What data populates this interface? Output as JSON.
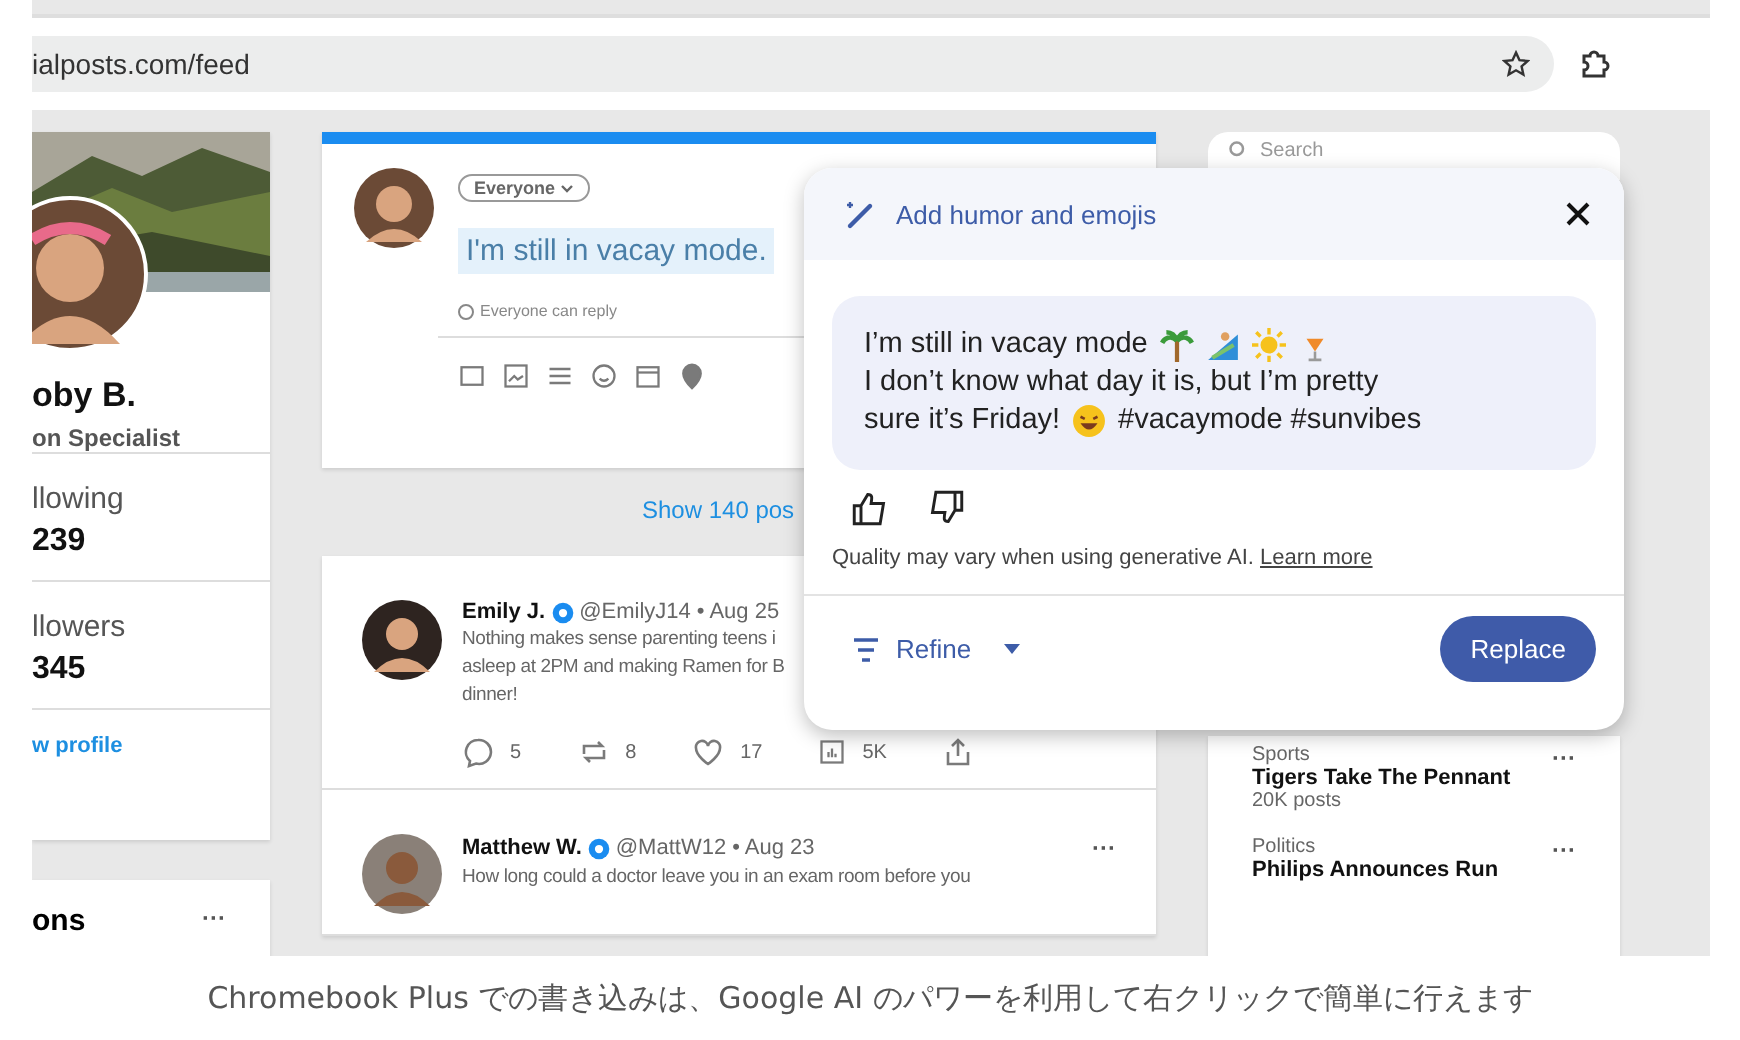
{
  "browser": {
    "url": "ialposts.com/feed"
  },
  "profile": {
    "name": "oby B.",
    "role": "on Specialist",
    "stats": [
      {
        "label": "llowing",
        "value": "239"
      },
      {
        "label": "llowers",
        "value": "345"
      }
    ],
    "link": "w profile"
  },
  "section": {
    "title": "ons",
    "more": "···"
  },
  "compose": {
    "audience": "Everyone",
    "text": "I'm still in vacay mode.",
    "reply_setting": "Everyone can reply"
  },
  "show_posts": "Show 140 pos",
  "posts": [
    {
      "name": "Emily J.",
      "handle": "@EmilyJ14 • Aug 25",
      "lines": [
        "Nothing makes sense parenting teens i",
        "asleep at 2PM and making Ramen for B",
        "dinner!"
      ],
      "stats": {
        "replies": "5",
        "reposts": "8",
        "likes": "17",
        "views": "5K"
      }
    },
    {
      "name": "Matthew W.",
      "handle": "@MattW12 • Aug 23",
      "lines": [
        "How long could a doctor leave you in an exam room before you"
      ],
      "more": "···"
    }
  ],
  "search": {
    "placeholder": "Search"
  },
  "trends": [
    {
      "category": "Sports",
      "title": "Tigers Take The Pennant",
      "count": "20K posts",
      "more": "···"
    },
    {
      "category": "Politics",
      "title": "Philips Announces Run",
      "more": "···"
    }
  ],
  "popup": {
    "title": "Add humor and emojis",
    "line_1": "I’m still in vacay mode",
    "line_2": "I don’t know what day it is, but I’m pretty",
    "line_3": "sure it’s Friday!",
    "hashtags": "#vacaymode #sunvibes",
    "disclaimer": "Quality may vary when using generative AI.",
    "link": "Learn more",
    "refine": "Refine",
    "replace": "Replace"
  },
  "caption": "Chromebook Plus での書き込みは、Google AI のパワーを利用して右クリックで簡単に行えます"
}
